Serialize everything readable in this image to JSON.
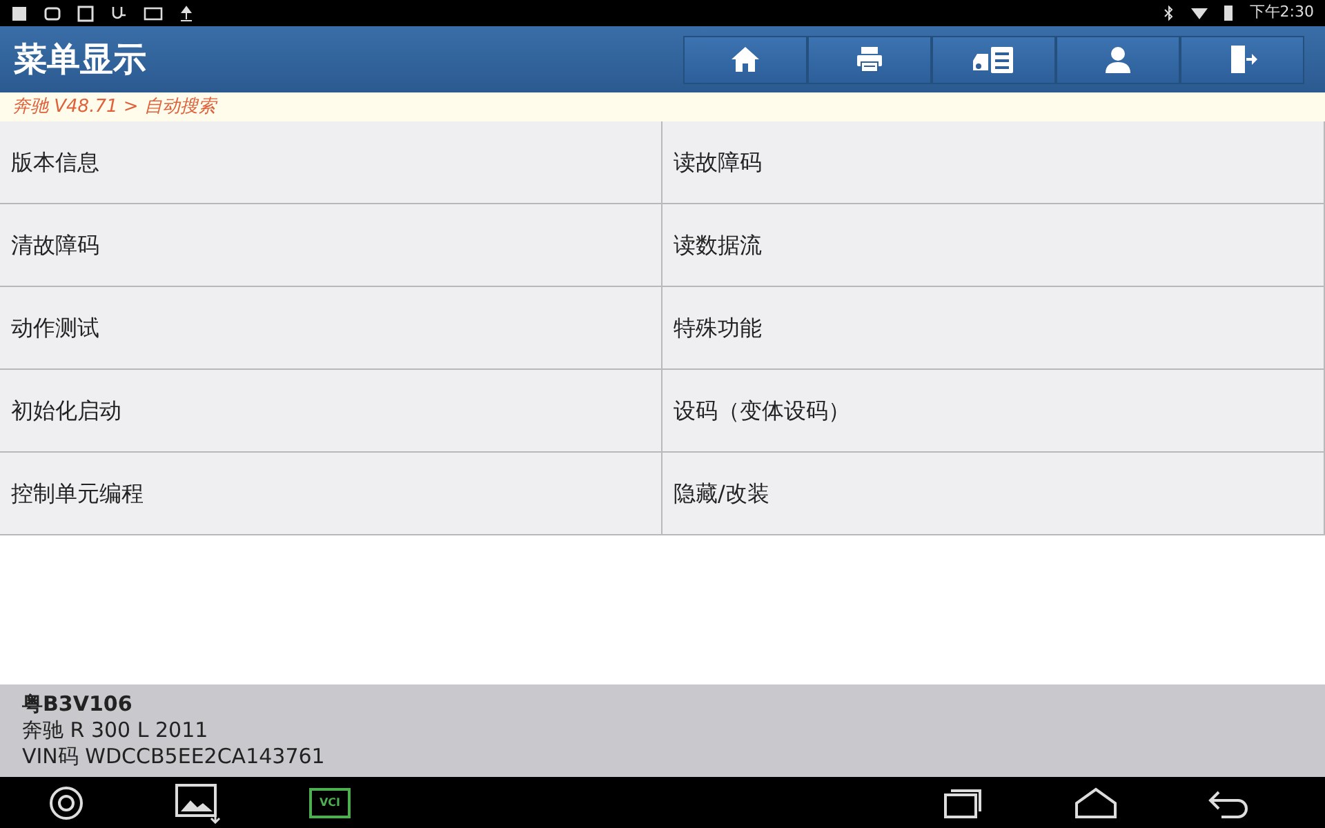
{
  "status_bar": {
    "time": "下午2:30"
  },
  "header": {
    "title": "菜单显示",
    "buttons": [
      {
        "kind": "home"
      },
      {
        "kind": "print"
      },
      {
        "kind": "report"
      },
      {
        "kind": "user"
      },
      {
        "kind": "exit"
      }
    ]
  },
  "breadcrumb": "奔驰 V48.71 > 自动搜索",
  "menu": [
    {
      "label": "版本信息"
    },
    {
      "label": "读故障码"
    },
    {
      "label": "清故障码"
    },
    {
      "label": "读数据流"
    },
    {
      "label": "动作测试"
    },
    {
      "label": "特殊功能"
    },
    {
      "label": "初始化启动"
    },
    {
      "label": "设码（变体设码）"
    },
    {
      "label": "控制单元编程"
    },
    {
      "label": "隐藏/改装"
    }
  ],
  "vehicle": {
    "plate": "粤B3V106",
    "model": "奔驰 R 300 L 2011",
    "vin": "VIN码 WDCCB5EE2CA143761"
  },
  "nav_bar": {
    "vci_label": "VCI"
  }
}
